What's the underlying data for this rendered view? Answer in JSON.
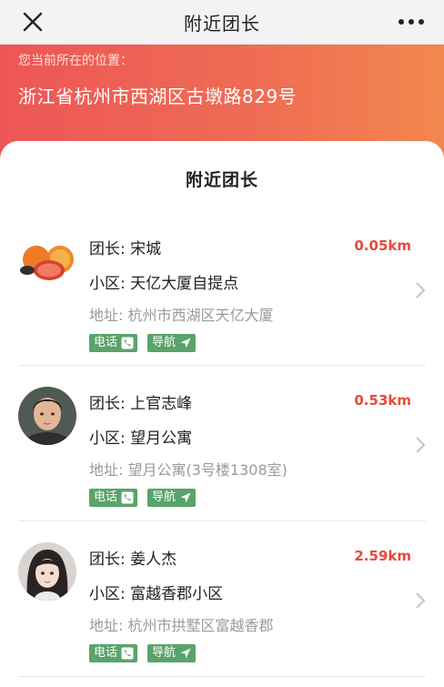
{
  "nav": {
    "title": "附近团长"
  },
  "location": {
    "label": "您当前所在的位置：",
    "address": "浙江省杭州市西湖区古墩路829号"
  },
  "panel": {
    "title": "附近团长"
  },
  "leaders": [
    {
      "name": "团长: 宋城",
      "distance": "0.05km",
      "community": "小区: 天亿大厦自提点",
      "address": "地址: 杭州市西湖区天亿大厦",
      "phone_label": "电话",
      "nav_label": "导航"
    },
    {
      "name": "团长: 上官志峰",
      "distance": "0.53km",
      "community": "小区: 望月公寓",
      "address": "地址: 望月公寓(3号楼1308室)",
      "phone_label": "电话",
      "nav_label": "导航"
    },
    {
      "name": "团长: 姜人杰",
      "distance": "2.59km",
      "community": "小区: 富越香郡小区",
      "address": "地址: 杭州市拱墅区富越香郡",
      "phone_label": "电话",
      "nav_label": "导航"
    }
  ],
  "colors": {
    "accent_red": "#e8493f",
    "tag_green": "#5aa36b",
    "hero_start": "#ed5656",
    "hero_end": "#f2874f"
  }
}
